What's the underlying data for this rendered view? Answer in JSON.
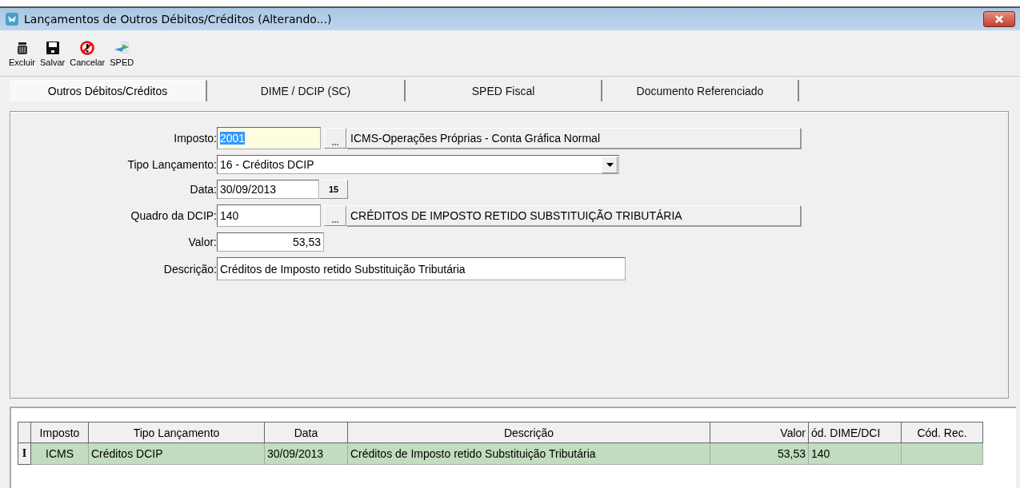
{
  "window": {
    "title": "Lançamentos de Outros Débitos/Créditos (Alterando...)"
  },
  "toolbar": [
    {
      "kind": "delete",
      "label": "Excluir"
    },
    {
      "kind": "save",
      "label": "Salvar"
    },
    {
      "kind": "cancel",
      "label": "Cancelar"
    },
    {
      "kind": "sped",
      "label": "SPED"
    }
  ],
  "tabs": [
    {
      "label": "Outros Débitos/Créditos",
      "selected": true
    },
    {
      "label": "DIME / DCIP (SC)",
      "selected": false
    },
    {
      "label": "SPED Fiscal",
      "selected": false
    },
    {
      "label": "Documento Referenciado",
      "selected": false
    }
  ],
  "form": [
    {
      "kind": "lookup",
      "label": "Imposto:",
      "value": "2001",
      "description": "ICMS-Operações Próprias - Conta Gráfica Normal",
      "highlighted": true
    },
    {
      "kind": "select",
      "label": "Tipo Lançamento:",
      "value": "16 - Créditos DCIP"
    },
    {
      "kind": "date",
      "label": "Data:",
      "value": "30/09/2013",
      "button": "15"
    },
    {
      "kind": "lookup",
      "label": "Quadro da DCIP:",
      "value": "140",
      "description": "CRÉDITOS DE IMPOSTO RETIDO SUBSTITUIÇÃO TRIBUTÁRIA",
      "highlighted": false
    },
    {
      "kind": "number",
      "label": "Valor:",
      "value": "53,53"
    },
    {
      "kind": "text",
      "label": "Descrição:",
      "value": "Créditos de Imposto retido Substituição Tributária"
    }
  ],
  "table": {
    "columns": [
      "Imposto",
      "Tipo Lançamento",
      "Data",
      "Descrição",
      "Valor",
      "ód. DIME/DCI",
      "Cód. Rec."
    ],
    "rows": [
      {
        "selected": true,
        "indicator": "I",
        "cells": [
          "ICMS",
          "Créditos DCIP",
          "30/09/2013",
          "Créditos de Imposto retido Substituição Tributária",
          "53,53",
          "140",
          ""
        ]
      }
    ]
  }
}
